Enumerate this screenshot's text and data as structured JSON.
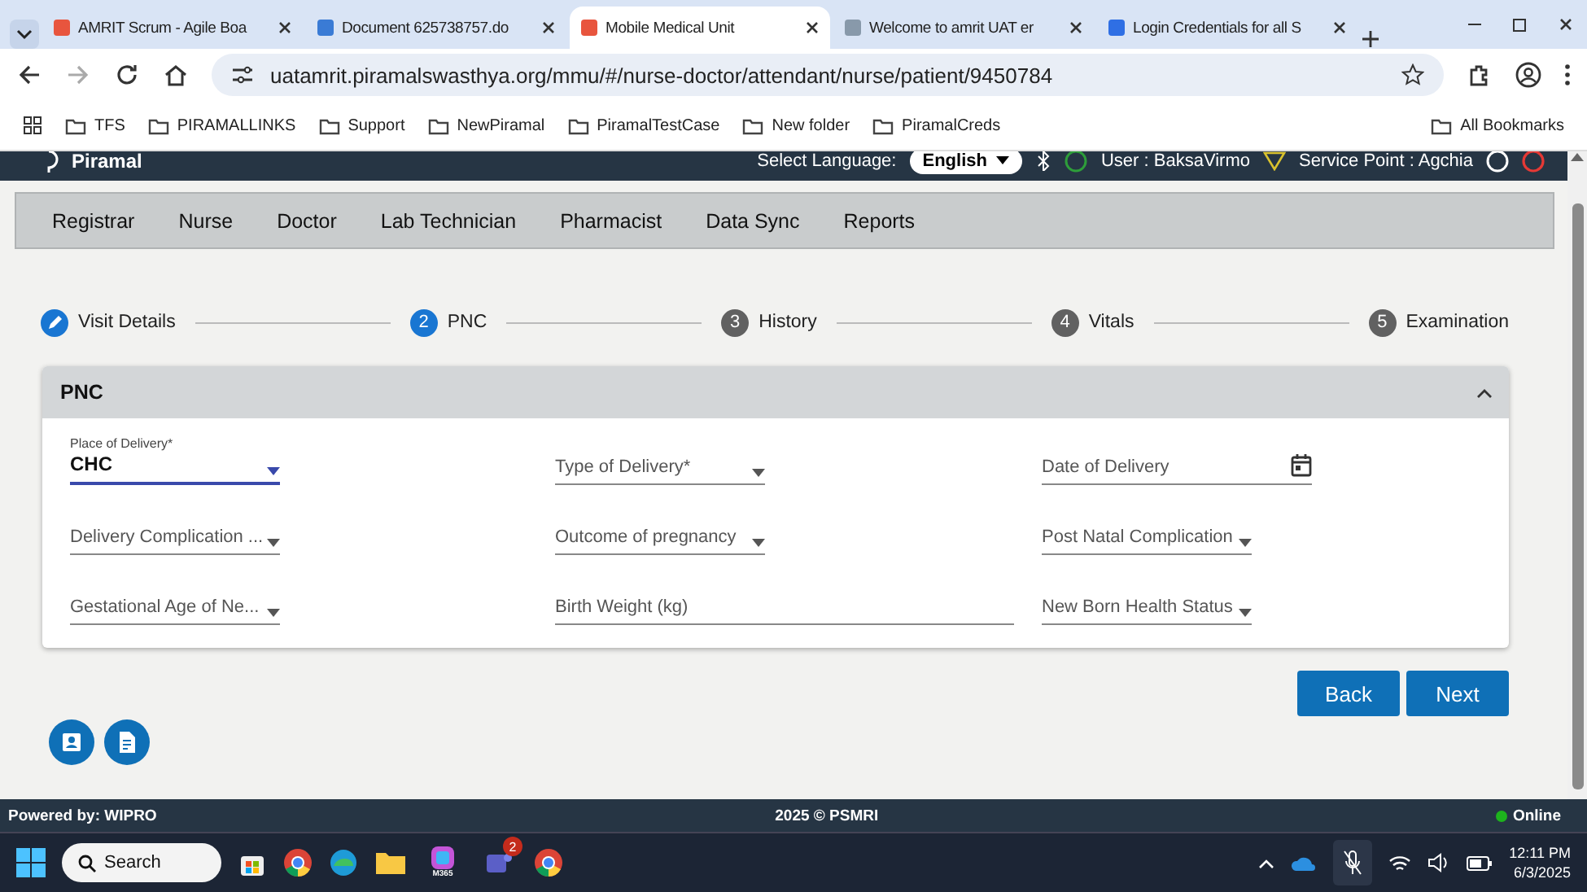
{
  "browser": {
    "tabs": [
      {
        "title": "AMRIT Scrum - Agile Boa",
        "selected": false
      },
      {
        "title": "Document 625738757.do",
        "selected": false
      },
      {
        "title": "Mobile Medical Unit",
        "selected": true
      },
      {
        "title": "Welcome to amrit UAT er",
        "selected": false
      },
      {
        "title": "Login Credentials for all S",
        "selected": false
      }
    ],
    "url": "uatamrit.piramalswasthya.org/mmu/#/nurse-doctor/attendant/nurse/patient/9450784",
    "bookmarks": [
      "TFS",
      "PIRAMALLINKS",
      "Support",
      "NewPiramal",
      "PiramalTestCase",
      "New folder",
      "PiramalCreds"
    ],
    "all_bookmarks": "All Bookmarks"
  },
  "header": {
    "brand": "Piramal",
    "language_label": "Select Language:",
    "language": "English",
    "user": "User : BaksaVirmo",
    "service_point": "Service Point : Agchia"
  },
  "nav": [
    "Registrar",
    "Nurse",
    "Doctor",
    "Lab Technician",
    "Pharmacist",
    "Data Sync",
    "Reports"
  ],
  "steps": [
    {
      "label": "Visit Details",
      "completed": true,
      "selected": false
    },
    {
      "number": "2",
      "label": "PNC",
      "completed": false,
      "selected": true
    },
    {
      "number": "3",
      "label": "History",
      "completed": false,
      "selected": false
    },
    {
      "number": "4",
      "label": "Vitals",
      "completed": false,
      "selected": false
    },
    {
      "number": "5",
      "label": "Examination",
      "completed": false,
      "selected": false
    }
  ],
  "panel": {
    "title": "PNC",
    "expanded": true,
    "fields": [
      {
        "label": "Place of Delivery*",
        "value": "CHC",
        "kind": "select"
      },
      {
        "label": "Type of Delivery*",
        "kind": "select"
      },
      {
        "label": "Date of Delivery",
        "kind": "date"
      },
      {
        "label": "Delivery Complication ...",
        "kind": "select"
      },
      {
        "label": "Outcome of pregnancy",
        "kind": "select"
      },
      {
        "label": "Post Natal Complication",
        "kind": "select"
      },
      {
        "label": "Gestational Age of Ne...",
        "kind": "select"
      },
      {
        "label": "Birth Weight (kg)",
        "kind": "text"
      },
      {
        "label": "New Born Health Status",
        "kind": "select"
      }
    ]
  },
  "buttons": [
    "Back",
    "Next"
  ],
  "footer": {
    "powered": "Powered by: WIPRO",
    "copyright": "2025 © PSMRI",
    "status": "Online",
    "online": true
  },
  "taskbar": {
    "search": "Search",
    "app_label": "M365",
    "badge": "2",
    "time": "12:11 PM",
    "date": "6/3/2025"
  }
}
